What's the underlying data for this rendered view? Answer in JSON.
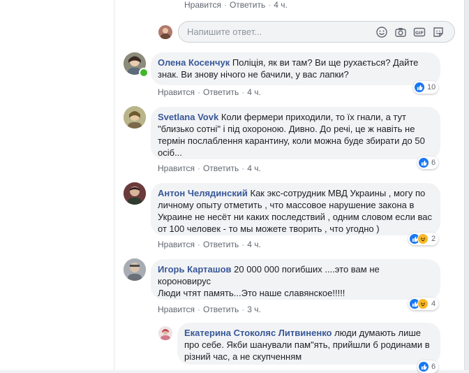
{
  "labels": {
    "like": "Нравится",
    "reply": "Ответить"
  },
  "top_row": {
    "time": "4 ч."
  },
  "reply_box": {
    "placeholder": "Напишите ответ..."
  },
  "comments": [
    {
      "author": "Олена Косенчук",
      "text": "Поліція, як ви там? Ви ще рухається? Дайте знак. Ви знову нічого не бачили, у вас лапки?",
      "time": "4 ч.",
      "reactions": "10"
    },
    {
      "author": "Svetlana Vovk",
      "text": "Коли фермери приходили, то їх гнали, а тут \"близько сотні\" і під охороною. Дивно. До речі, це ж навіть не термін послаблення карантину, коли можна буде збирати до 50 осіб...",
      "time": "4 ч.",
      "reactions": "6"
    },
    {
      "author": "Антон Челядинский",
      "text": "Как экс-сотрудник МВД Украины , могу по личному опыту отметить , что массовое нарушение закона в Украине не несёт ни каких последствий , одним словом если вас от 100 человек - то мы можете творить , что угодно )",
      "time": "4 ч.",
      "reactions": "2"
    },
    {
      "author": "Игорь Карташов",
      "text": "20 000 000 погибших ....это вам не короновирус",
      "text2": "Люди чтят память...Это наше славянское!!!!!",
      "time": "3 ч.",
      "reactions": "4"
    },
    {
      "author": "Екатерина Стоколяс Литвиненко",
      "text": "люди думають лише про себе. Якби шанували пам\"ять, прийшли б родинами в різний час, а не скупченням",
      "reactions": "6"
    }
  ],
  "colors": {
    "link": "#385898",
    "bubble": "#f2f3f5",
    "like_blue": "#1877f2",
    "haha_yellow": "#f7b928",
    "online_green": "#42b72a"
  },
  "icons": [
    "smiley-icon",
    "camera-icon",
    "gif-icon",
    "sticker-icon",
    "like-reaction-icon",
    "haha-reaction-icon"
  ]
}
